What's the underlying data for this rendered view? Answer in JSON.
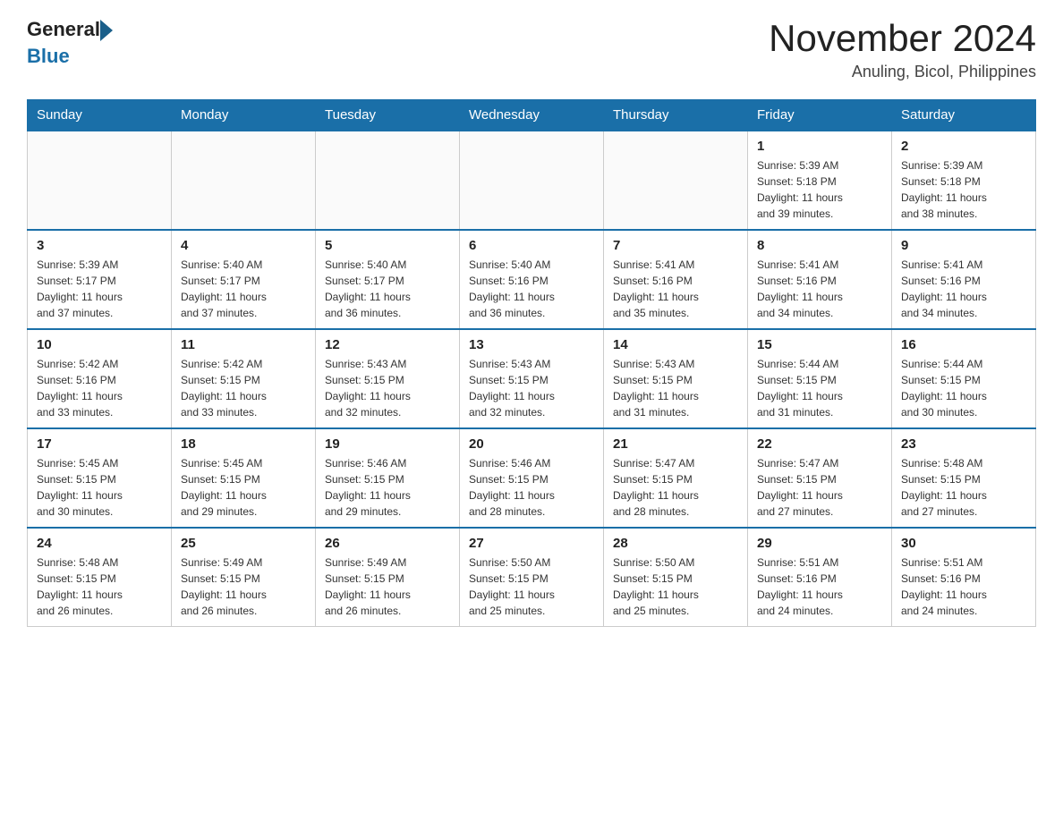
{
  "header": {
    "logo_text_general": "General",
    "logo_text_blue": "Blue",
    "month_year": "November 2024",
    "location": "Anuling, Bicol, Philippines"
  },
  "weekdays": [
    "Sunday",
    "Monday",
    "Tuesday",
    "Wednesday",
    "Thursday",
    "Friday",
    "Saturday"
  ],
  "weeks": [
    [
      {
        "day": "",
        "info": ""
      },
      {
        "day": "",
        "info": ""
      },
      {
        "day": "",
        "info": ""
      },
      {
        "day": "",
        "info": ""
      },
      {
        "day": "",
        "info": ""
      },
      {
        "day": "1",
        "info": "Sunrise: 5:39 AM\nSunset: 5:18 PM\nDaylight: 11 hours\nand 39 minutes."
      },
      {
        "day": "2",
        "info": "Sunrise: 5:39 AM\nSunset: 5:18 PM\nDaylight: 11 hours\nand 38 minutes."
      }
    ],
    [
      {
        "day": "3",
        "info": "Sunrise: 5:39 AM\nSunset: 5:17 PM\nDaylight: 11 hours\nand 37 minutes."
      },
      {
        "day": "4",
        "info": "Sunrise: 5:40 AM\nSunset: 5:17 PM\nDaylight: 11 hours\nand 37 minutes."
      },
      {
        "day": "5",
        "info": "Sunrise: 5:40 AM\nSunset: 5:17 PM\nDaylight: 11 hours\nand 36 minutes."
      },
      {
        "day": "6",
        "info": "Sunrise: 5:40 AM\nSunset: 5:16 PM\nDaylight: 11 hours\nand 36 minutes."
      },
      {
        "day": "7",
        "info": "Sunrise: 5:41 AM\nSunset: 5:16 PM\nDaylight: 11 hours\nand 35 minutes."
      },
      {
        "day": "8",
        "info": "Sunrise: 5:41 AM\nSunset: 5:16 PM\nDaylight: 11 hours\nand 34 minutes."
      },
      {
        "day": "9",
        "info": "Sunrise: 5:41 AM\nSunset: 5:16 PM\nDaylight: 11 hours\nand 34 minutes."
      }
    ],
    [
      {
        "day": "10",
        "info": "Sunrise: 5:42 AM\nSunset: 5:16 PM\nDaylight: 11 hours\nand 33 minutes."
      },
      {
        "day": "11",
        "info": "Sunrise: 5:42 AM\nSunset: 5:15 PM\nDaylight: 11 hours\nand 33 minutes."
      },
      {
        "day": "12",
        "info": "Sunrise: 5:43 AM\nSunset: 5:15 PM\nDaylight: 11 hours\nand 32 minutes."
      },
      {
        "day": "13",
        "info": "Sunrise: 5:43 AM\nSunset: 5:15 PM\nDaylight: 11 hours\nand 32 minutes."
      },
      {
        "day": "14",
        "info": "Sunrise: 5:43 AM\nSunset: 5:15 PM\nDaylight: 11 hours\nand 31 minutes."
      },
      {
        "day": "15",
        "info": "Sunrise: 5:44 AM\nSunset: 5:15 PM\nDaylight: 11 hours\nand 31 minutes."
      },
      {
        "day": "16",
        "info": "Sunrise: 5:44 AM\nSunset: 5:15 PM\nDaylight: 11 hours\nand 30 minutes."
      }
    ],
    [
      {
        "day": "17",
        "info": "Sunrise: 5:45 AM\nSunset: 5:15 PM\nDaylight: 11 hours\nand 30 minutes."
      },
      {
        "day": "18",
        "info": "Sunrise: 5:45 AM\nSunset: 5:15 PM\nDaylight: 11 hours\nand 29 minutes."
      },
      {
        "day": "19",
        "info": "Sunrise: 5:46 AM\nSunset: 5:15 PM\nDaylight: 11 hours\nand 29 minutes."
      },
      {
        "day": "20",
        "info": "Sunrise: 5:46 AM\nSunset: 5:15 PM\nDaylight: 11 hours\nand 28 minutes."
      },
      {
        "day": "21",
        "info": "Sunrise: 5:47 AM\nSunset: 5:15 PM\nDaylight: 11 hours\nand 28 minutes."
      },
      {
        "day": "22",
        "info": "Sunrise: 5:47 AM\nSunset: 5:15 PM\nDaylight: 11 hours\nand 27 minutes."
      },
      {
        "day": "23",
        "info": "Sunrise: 5:48 AM\nSunset: 5:15 PM\nDaylight: 11 hours\nand 27 minutes."
      }
    ],
    [
      {
        "day": "24",
        "info": "Sunrise: 5:48 AM\nSunset: 5:15 PM\nDaylight: 11 hours\nand 26 minutes."
      },
      {
        "day": "25",
        "info": "Sunrise: 5:49 AM\nSunset: 5:15 PM\nDaylight: 11 hours\nand 26 minutes."
      },
      {
        "day": "26",
        "info": "Sunrise: 5:49 AM\nSunset: 5:15 PM\nDaylight: 11 hours\nand 26 minutes."
      },
      {
        "day": "27",
        "info": "Sunrise: 5:50 AM\nSunset: 5:15 PM\nDaylight: 11 hours\nand 25 minutes."
      },
      {
        "day": "28",
        "info": "Sunrise: 5:50 AM\nSunset: 5:15 PM\nDaylight: 11 hours\nand 25 minutes."
      },
      {
        "day": "29",
        "info": "Sunrise: 5:51 AM\nSunset: 5:16 PM\nDaylight: 11 hours\nand 24 minutes."
      },
      {
        "day": "30",
        "info": "Sunrise: 5:51 AM\nSunset: 5:16 PM\nDaylight: 11 hours\nand 24 minutes."
      }
    ]
  ]
}
